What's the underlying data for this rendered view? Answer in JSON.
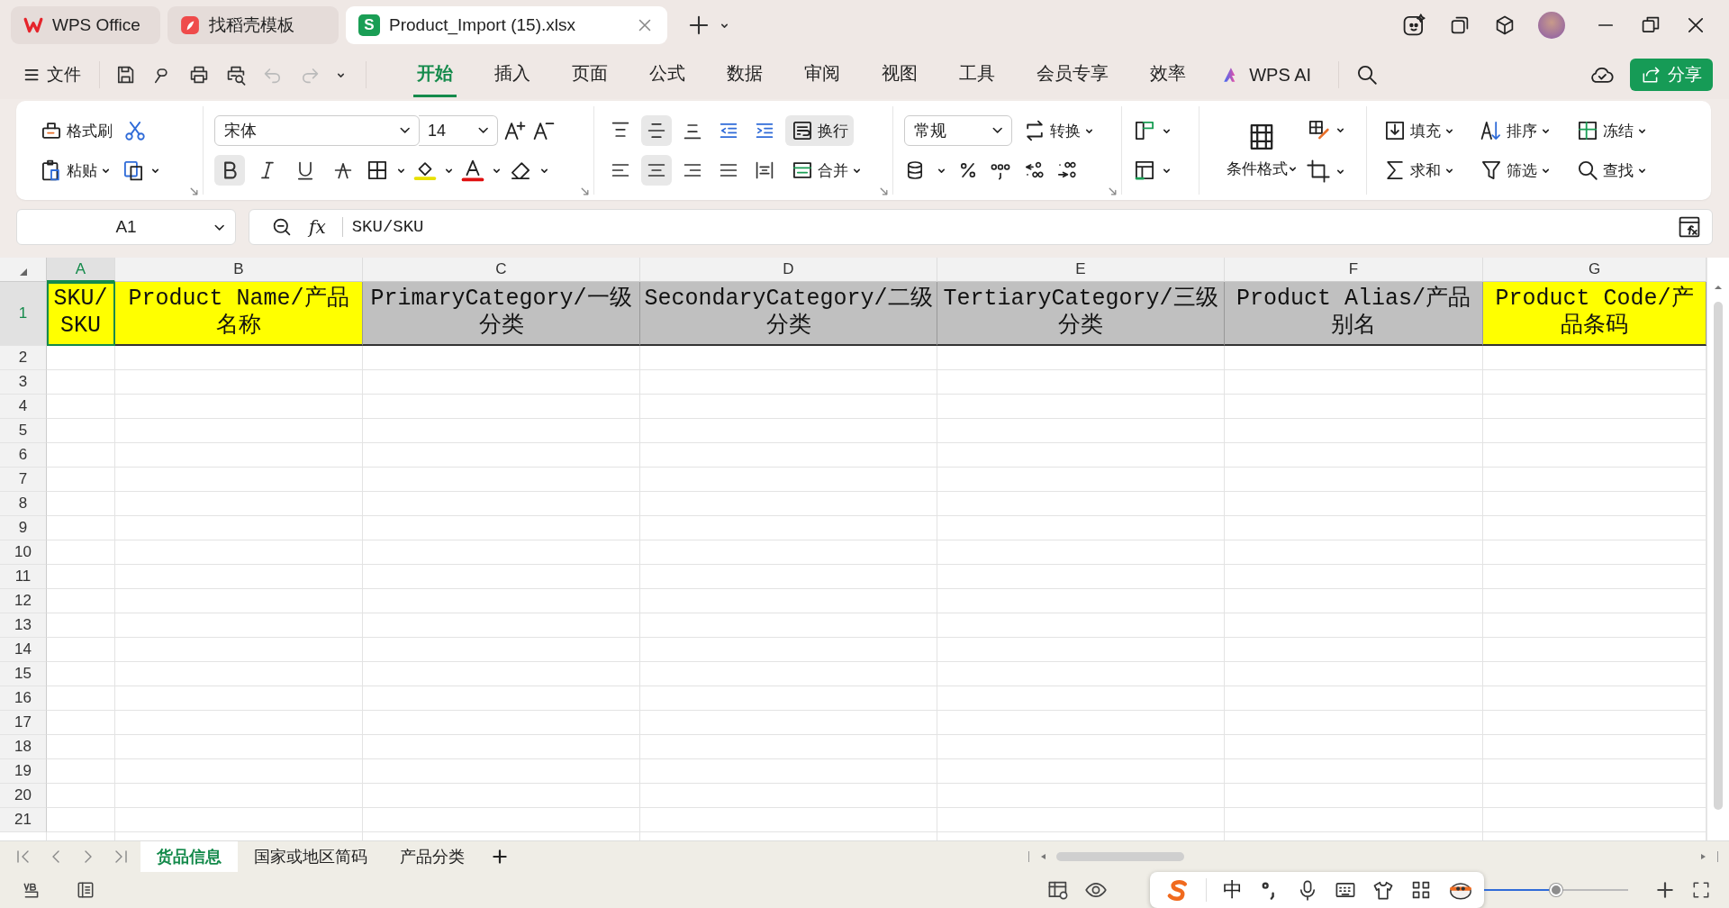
{
  "tabs": [
    {
      "kind": "app",
      "label": "WPS Office",
      "selected": false
    },
    {
      "kind": "template",
      "label": "找稻壳模板",
      "selected": false
    },
    {
      "kind": "document",
      "logo": "S",
      "label": "Product_Import (15).xlsx",
      "selected": true
    }
  ],
  "menu": {
    "file": "文件",
    "ai_button": "WPS AI",
    "share": "分享"
  },
  "ribbon_tabs": [
    {
      "label": "开始",
      "selected": true
    },
    {
      "label": "插入",
      "selected": false
    },
    {
      "label": "页面",
      "selected": false
    },
    {
      "label": "公式",
      "selected": false
    },
    {
      "label": "数据",
      "selected": false
    },
    {
      "label": "审阅",
      "selected": false
    },
    {
      "label": "视图",
      "selected": false
    },
    {
      "label": "工具",
      "selected": false
    },
    {
      "label": "会员专享",
      "selected": false
    },
    {
      "label": "效率",
      "selected": false
    }
  ],
  "ribbon": {
    "format_painter": "格式刷",
    "paste": "粘贴",
    "font": "宋体",
    "font_size": "14",
    "bold": true,
    "italic": false,
    "underline": false,
    "strikethrough": false,
    "vertical_align": [
      {
        "selected": false
      },
      {
        "selected": true
      },
      {
        "selected": false
      }
    ],
    "horizontal_align": [
      {
        "selected": false
      },
      {
        "selected": true
      },
      {
        "selected": false
      },
      {
        "selected": false
      },
      {
        "selected": false
      }
    ],
    "wrap_text": {
      "label": "换行",
      "on": true
    },
    "merge": "合并",
    "number_format": "常规",
    "convert": "转换",
    "conditional_format": "条件格式",
    "fill": "填充",
    "sort": "排序",
    "freeze": "冻结",
    "sum": "求和",
    "filter": "筛选",
    "find": "查找"
  },
  "formula_bar": {
    "name_box": "A1",
    "fx": "fx",
    "value": "SKU/SKU"
  },
  "sheet": {
    "columns": [
      {
        "label": "A",
        "selected": true
      },
      {
        "label": "B",
        "selected": false
      },
      {
        "label": "C",
        "selected": false
      },
      {
        "label": "D",
        "selected": false
      },
      {
        "label": "E",
        "selected": false
      },
      {
        "label": "F",
        "selected": false
      },
      {
        "label": "G",
        "selected": false
      }
    ],
    "rows": [
      {
        "label": "1",
        "selected": true
      },
      {
        "label": "2",
        "selected": false
      },
      {
        "label": "3",
        "selected": false
      },
      {
        "label": "4",
        "selected": false
      },
      {
        "label": "5",
        "selected": false
      },
      {
        "label": "6",
        "selected": false
      },
      {
        "label": "7",
        "selected": false
      },
      {
        "label": "8",
        "selected": false
      },
      {
        "label": "9",
        "selected": false
      },
      {
        "label": "10",
        "selected": false
      },
      {
        "label": "11",
        "selected": false
      },
      {
        "label": "12",
        "selected": false
      },
      {
        "label": "13",
        "selected": false
      },
      {
        "label": "14",
        "selected": false
      },
      {
        "label": "15",
        "selected": false
      },
      {
        "label": "16",
        "selected": false
      },
      {
        "label": "17",
        "selected": false
      },
      {
        "label": "18",
        "selected": false
      },
      {
        "label": "19",
        "selected": false
      },
      {
        "label": "20",
        "selected": false
      },
      {
        "label": "21",
        "selected": false
      }
    ],
    "header_cells": [
      {
        "text": "SKU/SKU",
        "color": "#ffff00",
        "selected": true
      },
      {
        "text": "Product Name/产品名称",
        "color": "#ffff00",
        "selected": false
      },
      {
        "text": "PrimaryCategory/一级分类",
        "color": "#c0c0c0",
        "selected": false
      },
      {
        "text": "SecondaryCategory/二级分类",
        "color": "#c0c0c0",
        "selected": false
      },
      {
        "text": "TertiaryCategory/三级分类",
        "color": "#c0c0c0",
        "selected": false
      },
      {
        "text": "Product Alias/产品别名",
        "color": "#c0c0c0",
        "selected": false
      },
      {
        "text": "Product Code/产品条码",
        "color": "#ffff00",
        "selected": false
      }
    ]
  },
  "sheet_tabs": [
    {
      "label": "货品信息",
      "selected": true
    },
    {
      "label": "国家或地区简码",
      "selected": false
    },
    {
      "label": "产品分类",
      "selected": false
    }
  ],
  "status": {
    "zoom": {
      "level": 0.5
    }
  },
  "ime": {
    "mode": "中"
  }
}
